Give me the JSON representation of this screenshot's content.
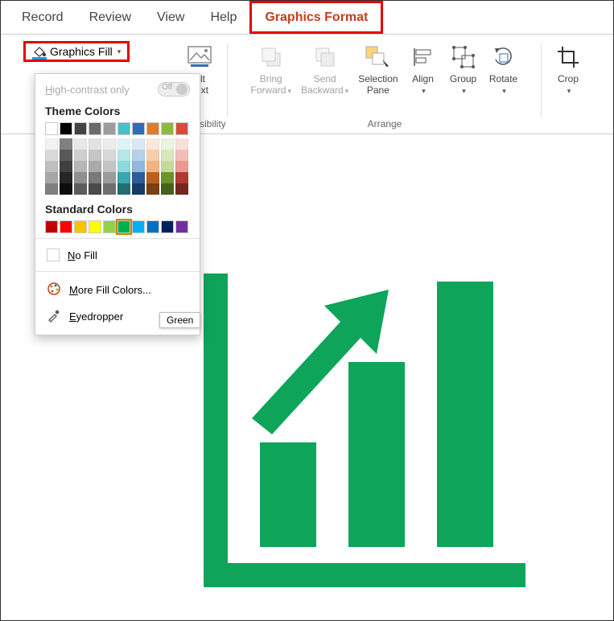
{
  "tabs": {
    "record": "Record",
    "review": "Review",
    "view": "View",
    "help": "Help",
    "graphics_format": "Graphics Format"
  },
  "fill_button": {
    "label": "Graphics Fill"
  },
  "ribbon": {
    "alt_text": "Alt\nText",
    "accessibility_group": "Accessibility",
    "bring_forward": "Bring\nForward",
    "send_backward": "Send\nBackward",
    "selection_pane": "Selection\nPane",
    "align": "Align",
    "group": "Group",
    "rotate": "Rotate",
    "arrange_group": "Arrange",
    "crop": "Crop"
  },
  "popup": {
    "high_contrast": "High-contrast only",
    "high_contrast_state": "Off",
    "theme_colors_title": "Theme Colors",
    "standard_colors_title": "Standard Colors",
    "no_fill": "No Fill",
    "more_colors": "More Fill Colors...",
    "eyedropper": "Eyedropper",
    "tooltip": "Green",
    "theme_row": [
      "#ffffff",
      "#000000",
      "#444444",
      "#6b6b6b",
      "#9c9c9c",
      "#44c1c9",
      "#2f6eb5",
      "#e07b2e",
      "#8fb93e",
      "#d94a3d"
    ],
    "tints": [
      [
        "#f2f2f2",
        "#d9d9d9",
        "#bfbfbf",
        "#a6a6a6",
        "#7f7f7f"
      ],
      [
        "#808080",
        "#595959",
        "#404040",
        "#262626",
        "#0d0d0d"
      ],
      [
        "#e8e8e8",
        "#cfcfcf",
        "#b6b6b6",
        "#8f8f8f",
        "#5c5c5c"
      ],
      [
        "#e2e2e2",
        "#c6c6c6",
        "#aaaaaa",
        "#7a7a7a",
        "#4a4a4a"
      ],
      [
        "#ececec",
        "#d8d8d8",
        "#c4c4c4",
        "#9b9b9b",
        "#6f6f6f"
      ],
      [
        "#dff4f5",
        "#b6e7ea",
        "#8cd9de",
        "#3aa6ad",
        "#1f6f74"
      ],
      [
        "#dbe7f4",
        "#b7cfe9",
        "#93b6de",
        "#2a5d99",
        "#173b63"
      ],
      [
        "#fbe8d8",
        "#f6ceac",
        "#f1b381",
        "#b85f1d",
        "#7a3f13"
      ],
      [
        "#ecf3de",
        "#d8e7bd",
        "#c3da9b",
        "#6d9230",
        "#47611f"
      ],
      [
        "#f9e0dd",
        "#f2bdb8",
        "#eb9a93",
        "#b13a30",
        "#76261f"
      ]
    ],
    "standard_row": [
      "#c00000",
      "#ff0000",
      "#ffc000",
      "#ffff00",
      "#92d050",
      "#00b050",
      "#00b0f0",
      "#0070c0",
      "#002060",
      "#7030a0"
    ],
    "selected_standard_index": 5
  },
  "graphic": {
    "color": "#0ea55a"
  }
}
